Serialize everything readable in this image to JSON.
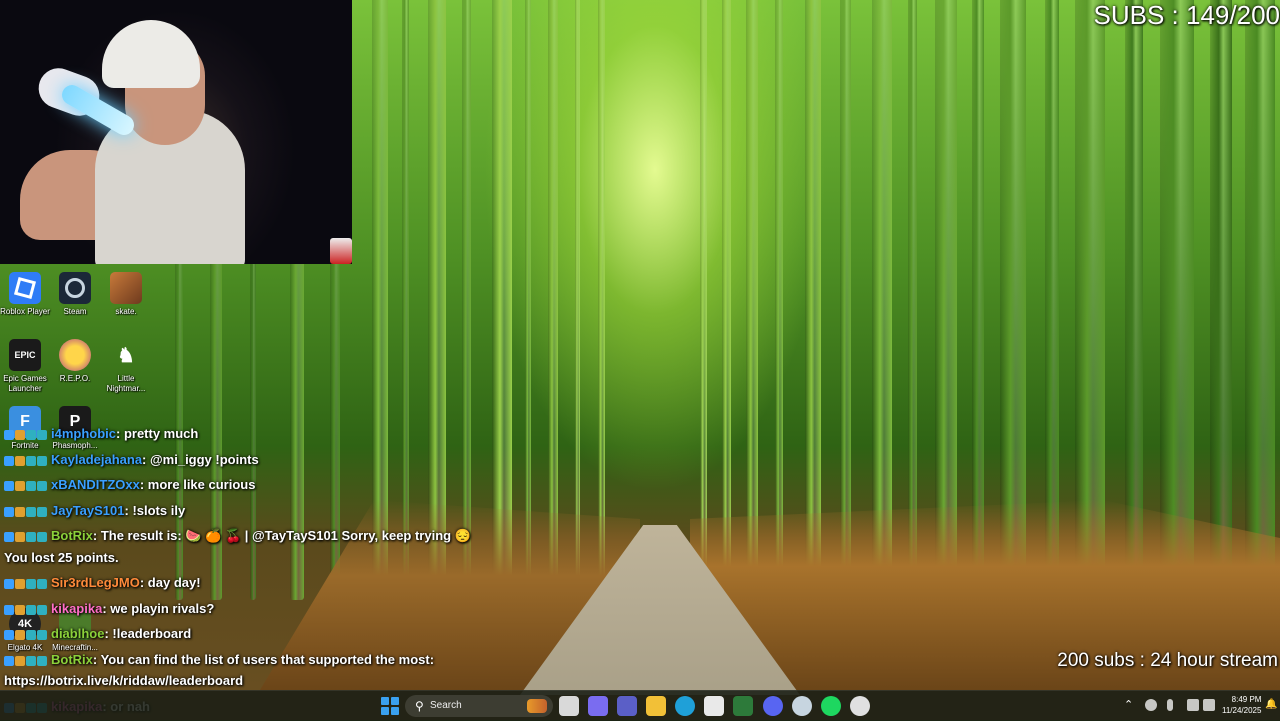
{
  "overlay": {
    "subs_counter": "SUBS : 149/200",
    "stream_goal": "200 subs : 24 hour stream"
  },
  "desktop_icons": [
    {
      "label": "Roblox Player",
      "color": "#2f7cf6"
    },
    {
      "label": "Steam",
      "color": "#1b2838"
    },
    {
      "label": "skate.",
      "color": "#c87a3a"
    },
    {
      "label": "Epic Games Launcher",
      "color": "#1a1a1a",
      "glyph": "EPIC"
    },
    {
      "label": "R.E.P.O.",
      "color": "#e8b12a"
    },
    {
      "label": "Little Nightmar...",
      "color": "#333333"
    },
    {
      "label": "Fortnite",
      "color": "#3a8fe0",
      "glyph": "F"
    },
    {
      "label": "Phasmoph...",
      "color": "#1a1a1a",
      "glyph": "P"
    },
    {
      "label": "Elgato 4K",
      "color": "#222222",
      "glyph": "4K"
    },
    {
      "label": "Minecraftin...",
      "color": "#4b7b2a"
    }
  ],
  "chat": [
    {
      "user": "i4mphobic",
      "user_color": "#3aa0ff",
      "message": ": pretty much"
    },
    {
      "user": "Kayladejahana",
      "user_color": "#3aa0ff",
      "message": ": @mi_iggy !points"
    },
    {
      "user": "xBANDITZOxx",
      "user_color": "#3aa0ff",
      "message": ": more like curious"
    },
    {
      "user": "JayTayS101",
      "user_color": "#3aa0ff",
      "message": ": !slots ily"
    },
    {
      "user": "BotRix",
      "user_color": "#8bd13a",
      "message": ": The result is: 🍉 🍊 🍒 | @TayTayS101 Sorry, keep trying 😔"
    },
    {
      "user": "",
      "user_color": "#ffffff",
      "message": "You lost 25 points."
    },
    {
      "user": "Sir3rdLegJMO",
      "user_color": "#ff8a3a",
      "message": ": day day!"
    },
    {
      "user": "kikapika",
      "user_color": "#ff6ec7",
      "message": ": we playin rivals?"
    },
    {
      "user": "diablhoe",
      "user_color": "#8bd13a",
      "message": ": !leaderboard"
    },
    {
      "user": "BotRix",
      "user_color": "#8bd13a",
      "message": ": You can find the list of users that supported the most:"
    },
    {
      "user": "",
      "user_color": "#ffffff",
      "message": "https://botrix.live/k/riddaw/leaderboard"
    },
    {
      "user": "kikapika",
      "user_color": "#ff6ec7",
      "message": ": or nah"
    }
  ],
  "taskbar": {
    "search_placeholder": "Search",
    "search_icon": "search-icon",
    "apps": [
      {
        "name": "task-view-icon",
        "color": "#d9d9d9"
      },
      {
        "name": "copilot-icon",
        "color": "#7a6cf0"
      },
      {
        "name": "teams-icon",
        "color": "#5b5fc7"
      },
      {
        "name": "file-explorer-icon",
        "color": "#f2c037"
      },
      {
        "name": "edge-icon",
        "color": "#1fa0d8"
      },
      {
        "name": "store-icon",
        "color": "#e9e9e9"
      },
      {
        "name": "app-green-icon",
        "color": "#2d7a3a"
      },
      {
        "name": "discord-icon",
        "color": "#5865f2"
      },
      {
        "name": "steam-icon",
        "color": "#c7d5e0"
      },
      {
        "name": "spotify-icon",
        "color": "#1ed760"
      },
      {
        "name": "obs-icon",
        "color": "#e0e0e0"
      }
    ],
    "clock_time": "8:49 PM",
    "clock_date": "11/24/2025"
  }
}
